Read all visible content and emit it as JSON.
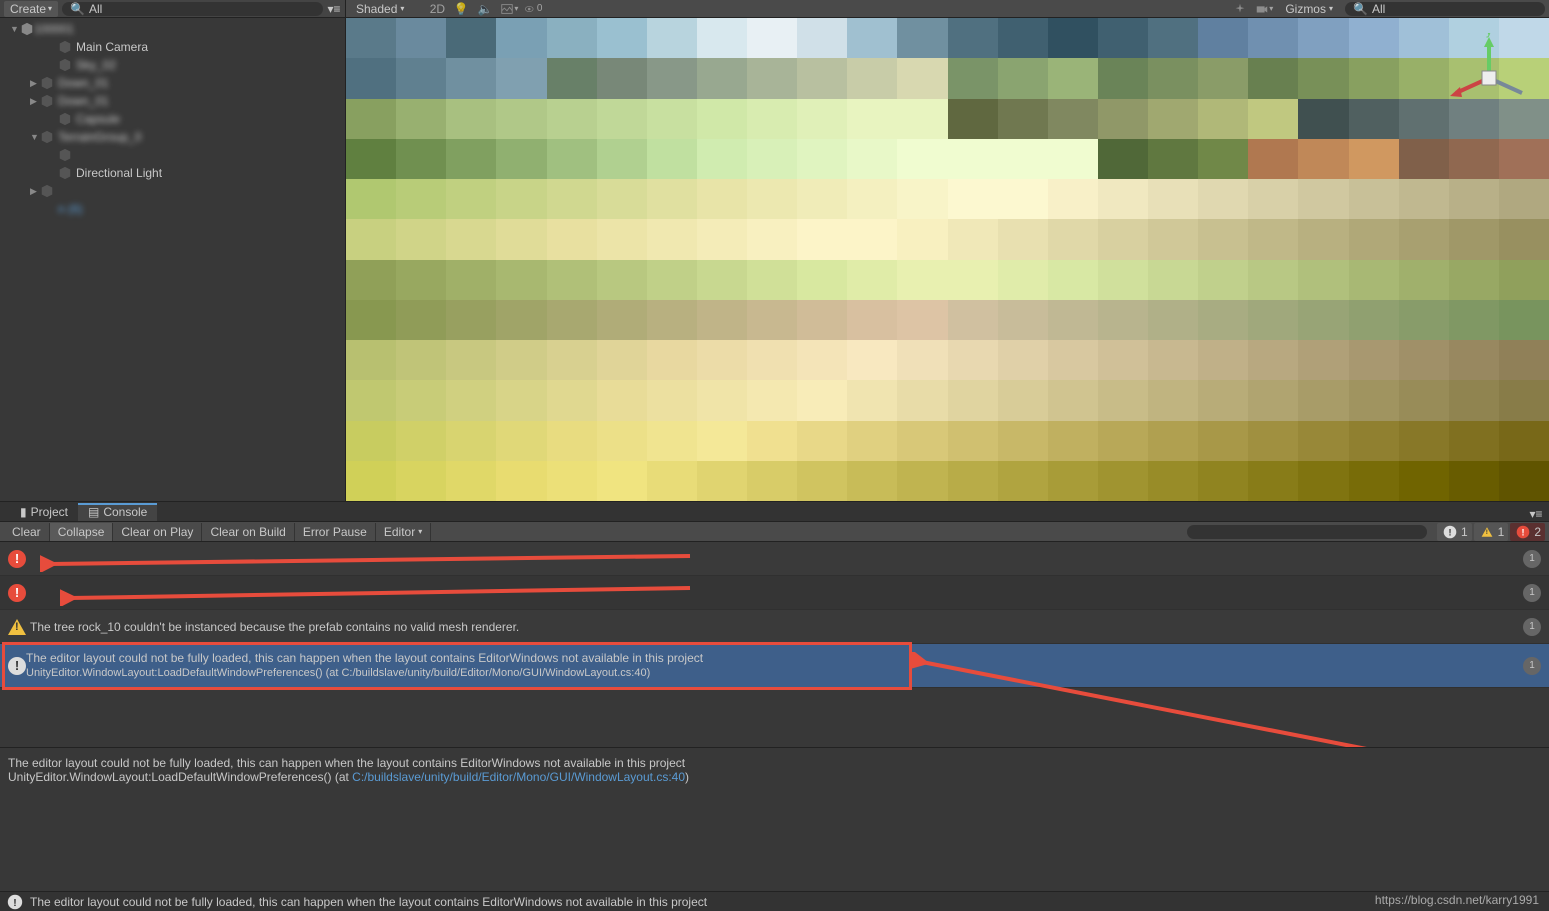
{
  "hierarchy": {
    "create_label": "Create",
    "search_placeholder": "All",
    "items": [
      {
        "label": "100001",
        "indent": 0,
        "arrow": "▼",
        "blur": true
      },
      {
        "label": "Main Camera",
        "indent": 2,
        "arrow": ""
      },
      {
        "label": "Sky_02",
        "indent": 2,
        "arrow": "",
        "blur": true
      },
      {
        "label": "Down_01",
        "indent": 1,
        "arrow": "▶",
        "blur": true
      },
      {
        "label": "Down_01",
        "indent": 1,
        "arrow": "▶",
        "blur": true
      },
      {
        "label": "Capsule",
        "indent": 2,
        "arrow": "",
        "blur": true
      },
      {
        "label": "TerrainGroup_0",
        "indent": 1,
        "arrow": "▼",
        "blur": true
      },
      {
        "label": " ",
        "indent": 2,
        "arrow": "",
        "blur": true
      },
      {
        "label": "Directional Light",
        "indent": 2,
        "arrow": ""
      },
      {
        "label": " ",
        "indent": 1,
        "arrow": "▶",
        "blur": true
      },
      {
        "label": "  n (6)",
        "indent": 2,
        "arrow": "",
        "link": true,
        "blur": true
      }
    ]
  },
  "scene": {
    "shading_mode": "Shaded",
    "mode_2d": "2D",
    "audio_toggle": "🔈",
    "fx_toggle": "💡",
    "gizmos_label": "Gizmos",
    "search_placeholder": "All",
    "axis_y": "y",
    "zero_label": "0"
  },
  "tabs": {
    "project": "Project",
    "console": "Console"
  },
  "console": {
    "clear": "Clear",
    "collapse": "Collapse",
    "clear_on_play": "Clear on Play",
    "clear_on_build": "Clear on Build",
    "error_pause": "Error Pause",
    "editor": "Editor",
    "counter_info": "1",
    "counter_warn": "1",
    "counter_error": "2",
    "messages": [
      {
        "type": "error",
        "text": "",
        "count": "1"
      },
      {
        "type": "error",
        "text": "",
        "count": "1"
      },
      {
        "type": "warn",
        "text": "The tree rock_10 couldn't be instanced because the prefab contains no valid mesh renderer.",
        "count": "1"
      },
      {
        "type": "info",
        "text": "The editor layout could not be fully loaded, this can happen when the layout contains EditorWindows not available in this project",
        "path": "UnityEditor.WindowLayout:LoadDefaultWindowPreferences() (at C:/buildslave/unity/build/Editor/Mono/GUI/WindowLayout.cs:40)",
        "count": "1",
        "selected": true
      }
    ],
    "detail_line1": "The editor layout could not be fully loaded, this can happen when the layout contains EditorWindows not available in this project",
    "detail_line2a": "UnityEditor.WindowLayout:LoadDefaultWindowPreferences() (at ",
    "detail_line2b": "C:/buildslave/unity/build/Editor/Mono/GUI/WindowLayout.cs:40",
    "detail_line2c": ")",
    "status_text": "The editor layout could not be fully loaded, this can happen when the layout contains EditorWindows not available in this project"
  },
  "watermark": "https://blog.csdn.net/karry1991"
}
